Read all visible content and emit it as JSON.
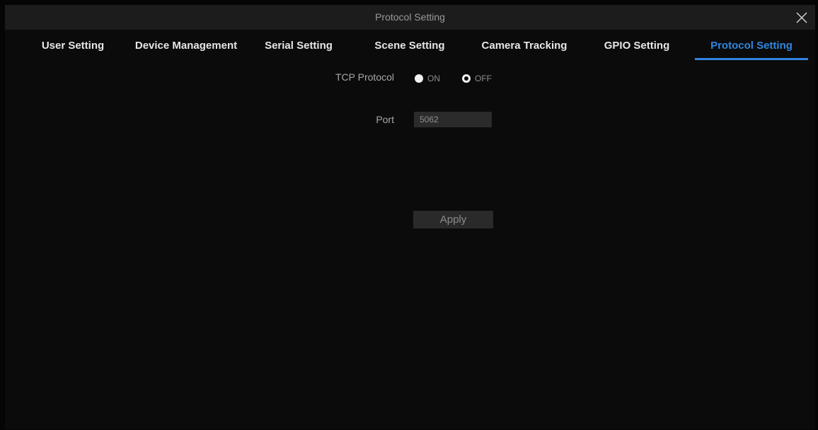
{
  "window": {
    "title": "Protocol Setting",
    "close_icon": "close-icon"
  },
  "tabs": [
    {
      "label": "User Setting",
      "active": false
    },
    {
      "label": "Device Management",
      "active": false
    },
    {
      "label": "Serial Setting",
      "active": false
    },
    {
      "label": "Scene Setting",
      "active": false
    },
    {
      "label": "Camera Tracking",
      "active": false
    },
    {
      "label": "GPIO Setting",
      "active": false
    },
    {
      "label": "Protocol Setting",
      "active": true
    }
  ],
  "form": {
    "tcp_protocol": {
      "label": "TCP Protocol",
      "options": [
        {
          "label": "ON",
          "selected": false
        },
        {
          "label": "OFF",
          "selected": true
        }
      ]
    },
    "port": {
      "label": "Port",
      "value": "5062"
    },
    "apply_label": "Apply"
  },
  "colors": {
    "accent": "#2f86e0",
    "background": "#0b0b0b",
    "titlebar": "#1c1c1c"
  }
}
